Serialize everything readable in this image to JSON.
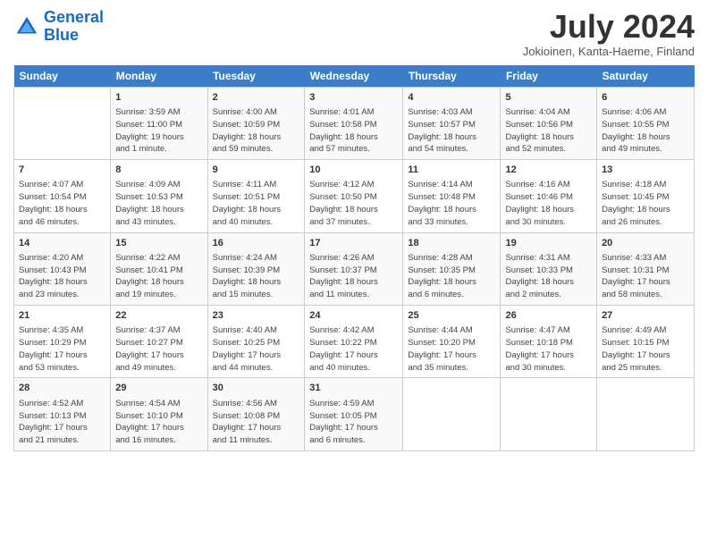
{
  "header": {
    "logo_line1": "General",
    "logo_line2": "Blue",
    "month_year": "July 2024",
    "location": "Jokioinen, Kanta-Haeme, Finland"
  },
  "days_of_week": [
    "Sunday",
    "Monday",
    "Tuesday",
    "Wednesday",
    "Thursday",
    "Friday",
    "Saturday"
  ],
  "weeks": [
    [
      {
        "day": "",
        "info": ""
      },
      {
        "day": "1",
        "info": "Sunrise: 3:59 AM\nSunset: 11:00 PM\nDaylight: 19 hours\nand 1 minute."
      },
      {
        "day": "2",
        "info": "Sunrise: 4:00 AM\nSunset: 10:59 PM\nDaylight: 18 hours\nand 59 minutes."
      },
      {
        "day": "3",
        "info": "Sunrise: 4:01 AM\nSunset: 10:58 PM\nDaylight: 18 hours\nand 57 minutes."
      },
      {
        "day": "4",
        "info": "Sunrise: 4:03 AM\nSunset: 10:57 PM\nDaylight: 18 hours\nand 54 minutes."
      },
      {
        "day": "5",
        "info": "Sunrise: 4:04 AM\nSunset: 10:56 PM\nDaylight: 18 hours\nand 52 minutes."
      },
      {
        "day": "6",
        "info": "Sunrise: 4:06 AM\nSunset: 10:55 PM\nDaylight: 18 hours\nand 49 minutes."
      }
    ],
    [
      {
        "day": "7",
        "info": "Sunrise: 4:07 AM\nSunset: 10:54 PM\nDaylight: 18 hours\nand 46 minutes."
      },
      {
        "day": "8",
        "info": "Sunrise: 4:09 AM\nSunset: 10:53 PM\nDaylight: 18 hours\nand 43 minutes."
      },
      {
        "day": "9",
        "info": "Sunrise: 4:11 AM\nSunset: 10:51 PM\nDaylight: 18 hours\nand 40 minutes."
      },
      {
        "day": "10",
        "info": "Sunrise: 4:12 AM\nSunset: 10:50 PM\nDaylight: 18 hours\nand 37 minutes."
      },
      {
        "day": "11",
        "info": "Sunrise: 4:14 AM\nSunset: 10:48 PM\nDaylight: 18 hours\nand 33 minutes."
      },
      {
        "day": "12",
        "info": "Sunrise: 4:16 AM\nSunset: 10:46 PM\nDaylight: 18 hours\nand 30 minutes."
      },
      {
        "day": "13",
        "info": "Sunrise: 4:18 AM\nSunset: 10:45 PM\nDaylight: 18 hours\nand 26 minutes."
      }
    ],
    [
      {
        "day": "14",
        "info": "Sunrise: 4:20 AM\nSunset: 10:43 PM\nDaylight: 18 hours\nand 23 minutes."
      },
      {
        "day": "15",
        "info": "Sunrise: 4:22 AM\nSunset: 10:41 PM\nDaylight: 18 hours\nand 19 minutes."
      },
      {
        "day": "16",
        "info": "Sunrise: 4:24 AM\nSunset: 10:39 PM\nDaylight: 18 hours\nand 15 minutes."
      },
      {
        "day": "17",
        "info": "Sunrise: 4:26 AM\nSunset: 10:37 PM\nDaylight: 18 hours\nand 11 minutes."
      },
      {
        "day": "18",
        "info": "Sunrise: 4:28 AM\nSunset: 10:35 PM\nDaylight: 18 hours\nand 6 minutes."
      },
      {
        "day": "19",
        "info": "Sunrise: 4:31 AM\nSunset: 10:33 PM\nDaylight: 18 hours\nand 2 minutes."
      },
      {
        "day": "20",
        "info": "Sunrise: 4:33 AM\nSunset: 10:31 PM\nDaylight: 17 hours\nand 58 minutes."
      }
    ],
    [
      {
        "day": "21",
        "info": "Sunrise: 4:35 AM\nSunset: 10:29 PM\nDaylight: 17 hours\nand 53 minutes."
      },
      {
        "day": "22",
        "info": "Sunrise: 4:37 AM\nSunset: 10:27 PM\nDaylight: 17 hours\nand 49 minutes."
      },
      {
        "day": "23",
        "info": "Sunrise: 4:40 AM\nSunset: 10:25 PM\nDaylight: 17 hours\nand 44 minutes."
      },
      {
        "day": "24",
        "info": "Sunrise: 4:42 AM\nSunset: 10:22 PM\nDaylight: 17 hours\nand 40 minutes."
      },
      {
        "day": "25",
        "info": "Sunrise: 4:44 AM\nSunset: 10:20 PM\nDaylight: 17 hours\nand 35 minutes."
      },
      {
        "day": "26",
        "info": "Sunrise: 4:47 AM\nSunset: 10:18 PM\nDaylight: 17 hours\nand 30 minutes."
      },
      {
        "day": "27",
        "info": "Sunrise: 4:49 AM\nSunset: 10:15 PM\nDaylight: 17 hours\nand 25 minutes."
      }
    ],
    [
      {
        "day": "28",
        "info": "Sunrise: 4:52 AM\nSunset: 10:13 PM\nDaylight: 17 hours\nand 21 minutes."
      },
      {
        "day": "29",
        "info": "Sunrise: 4:54 AM\nSunset: 10:10 PM\nDaylight: 17 hours\nand 16 minutes."
      },
      {
        "day": "30",
        "info": "Sunrise: 4:56 AM\nSunset: 10:08 PM\nDaylight: 17 hours\nand 11 minutes."
      },
      {
        "day": "31",
        "info": "Sunrise: 4:59 AM\nSunset: 10:05 PM\nDaylight: 17 hours\nand 6 minutes."
      },
      {
        "day": "",
        "info": ""
      },
      {
        "day": "",
        "info": ""
      },
      {
        "day": "",
        "info": ""
      }
    ]
  ]
}
